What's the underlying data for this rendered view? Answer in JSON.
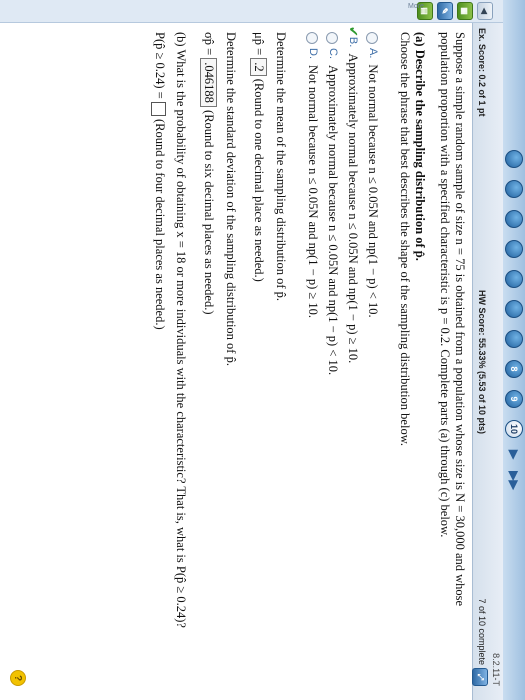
{
  "pager": {
    "pages": [
      "",
      "",
      "",
      "",
      "",
      "",
      "",
      "8",
      "9",
      "10"
    ],
    "current": "10",
    "next": "▶",
    "last": "▶▶"
  },
  "scores": {
    "ex_score": "Ex. Score: 0.2 of 1 pt",
    "hw_score": "HW Score: 55.33% (5.53 of 10 pts)",
    "progress": "7 of 10 complete",
    "question_id": "8.2.11-T"
  },
  "toolbar": {
    "more": "More"
  },
  "question": {
    "intro_line1": "Suppose a simple random sample of size n = 75 is obtained from a population whose size is N = 30,000 and whose",
    "intro_line2": "population proportion with a specified characteristic is p = 0.2. Complete parts (a) through (c) below.",
    "part_a_title": "(a) Describe the sampling distribution of p̂.",
    "part_a_prompt": "Choose the phrase that best describes the shape of the sampling distribution below.",
    "choices": [
      {
        "letter": "A.",
        "text": "Not normal because n ≤ 0.05N and np(1 − p) < 10."
      },
      {
        "letter": "B.",
        "text": "Approximately normal because n ≤ 0.05N and np(1 − p) ≥ 10."
      },
      {
        "letter": "C.",
        "text": "Approximately normal because n ≤ 0.05N and np(1 − p) < 10."
      },
      {
        "letter": "D.",
        "text": "Not normal because n ≤ 0.05N and np(1 − p) ≥ 10."
      }
    ],
    "mean_prompt": "Determine the mean of the sampling distribution of p̂.",
    "mean_label": "μp̂ =",
    "mean_value": ".2",
    "mean_hint": "(Round to one decimal place as needed.)",
    "sd_prompt": "Determine the standard deviation of the sampling distribution of p̂.",
    "sd_label": "σp̂ =",
    "sd_value": ".046188",
    "sd_hint": "(Round to six decimal places as needed.)",
    "part_b": "(b) What is the probability of obtaining x = 18 or more individuals with the characteristic? That is, what is P(p̂ ≥ 0.24)?",
    "prob_label": "P(p̂ ≥ 0.24) =",
    "prob_hint": "(Round to four decimal places as needed.)"
  }
}
